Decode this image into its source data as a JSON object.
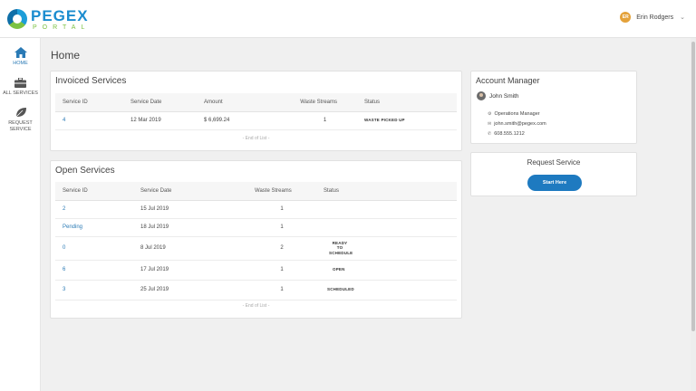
{
  "header": {
    "logo_main": "PEGEX",
    "logo_sub": "PORTAL",
    "user_initials": "ER",
    "user_name": "Erin Rodgers"
  },
  "sidebar": {
    "items": [
      {
        "label": "HOME",
        "icon": "home-icon"
      },
      {
        "label": "ALL SERVICES",
        "icon": "briefcase-icon"
      },
      {
        "label_line1": "REQUEST",
        "label_line2": "SERVICE",
        "icon": "leaf-icon"
      }
    ]
  },
  "page_title": "Home",
  "invoiced": {
    "title": "Invoiced Services",
    "columns": [
      "Service ID",
      "Service Date",
      "Amount",
      "Waste Streams",
      "Status"
    ],
    "rows": [
      {
        "id": "4",
        "date": "12 Mar 2019",
        "amount": "$ 6,699.24",
        "streams": "1",
        "status": "WASTE PICKED UP"
      }
    ],
    "end_text": "- End of List -"
  },
  "open": {
    "title": "Open Services",
    "columns": [
      "Service ID",
      "Service Date",
      "Waste Streams",
      "Status"
    ],
    "rows": [
      {
        "id": "2",
        "date": "15 Jul 2019",
        "streams": "1",
        "status": ""
      },
      {
        "id": "Pending",
        "date": "18 Jul 2019",
        "streams": "1",
        "status": ""
      },
      {
        "id": "0",
        "date": "8 Jul 2019",
        "streams": "2",
        "status_line1": "READY TO",
        "status_line2": "SCHEDULE"
      },
      {
        "id": "6",
        "date": "17 Jul 2019",
        "streams": "1",
        "status": "OPEN"
      },
      {
        "id": "3",
        "date": "25 Jul 2019",
        "streams": "1",
        "status": "SCHEDULED"
      }
    ],
    "end_text": "- End of List -"
  },
  "account_manager": {
    "title": "Account Manager",
    "name": "John Smith",
    "role": "Operations Manager",
    "email": "john.smith@pegex.com",
    "phone": "608.555.1212"
  },
  "request_service": {
    "title": "Request Service",
    "button": "Start Here"
  },
  "colors": {
    "accent": "#1e7ac0",
    "link": "#2a7ab5"
  }
}
